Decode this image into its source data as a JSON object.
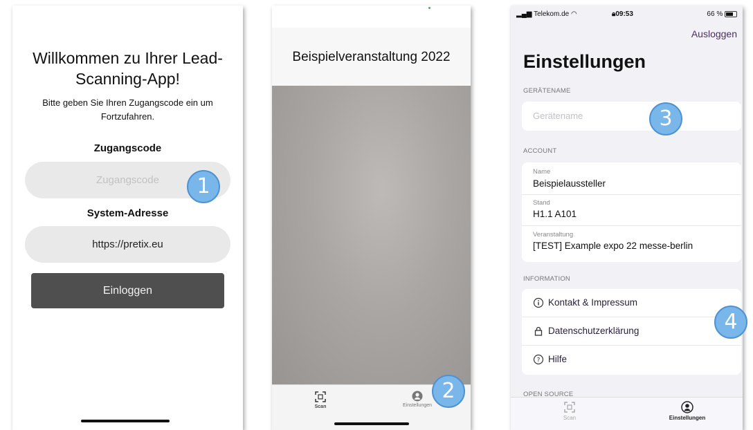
{
  "login": {
    "title": "Willkommen zu Ihrer Lead-Scanning-App!",
    "subtitle": "Bitte geben Sie Ihren Zugangscode ein um Fortzufahren.",
    "code_label": "Zugangscode",
    "code_placeholder": "Zugangscode",
    "system_label": "System-Adresse",
    "system_value": "https://pretix.eu",
    "login_button": "Einloggen"
  },
  "scanner": {
    "event_title": "Beispielveranstaltung 2022",
    "tabs": [
      {
        "label": "Scan",
        "icon": "scan-icon"
      },
      {
        "label": "Einstellungen",
        "icon": "person-icon"
      }
    ]
  },
  "settings": {
    "status": {
      "carrier": "Telekom.de",
      "time": "09:53",
      "battery": "66 %"
    },
    "logout": "Ausloggen",
    "title": "Einstellungen",
    "device_section": "GERÄTENAME",
    "device_placeholder": "Gerätename",
    "account_section": "ACCOUNT",
    "account": [
      {
        "label": "Name",
        "value": "Beispielaussteller"
      },
      {
        "label": "Stand",
        "value": "H1.1 A101"
      },
      {
        "label": "Veranstaltung",
        "value": "[TEST] Example expo 22 messe-berlin"
      }
    ],
    "info_section": "INFORMATION",
    "info_links": [
      {
        "label": "Kontakt & Impressum",
        "icon": "info-icon"
      },
      {
        "label": "Datenschutzerklärung",
        "icon": "lock-icon"
      },
      {
        "label": "Hilfe",
        "icon": "help-icon"
      }
    ],
    "open_source_section": "OPEN SOURCE",
    "tabs": [
      {
        "label": "Scan",
        "icon": "scan-icon"
      },
      {
        "label": "Einstellungen",
        "icon": "person-icon"
      }
    ]
  },
  "badges": [
    "1",
    "2",
    "3",
    "4"
  ],
  "colors": {
    "badge_fill": "#79b6ea",
    "badge_border": "#4e92d2",
    "accent": "#4a2e5e",
    "button": "#4f4f4f"
  }
}
